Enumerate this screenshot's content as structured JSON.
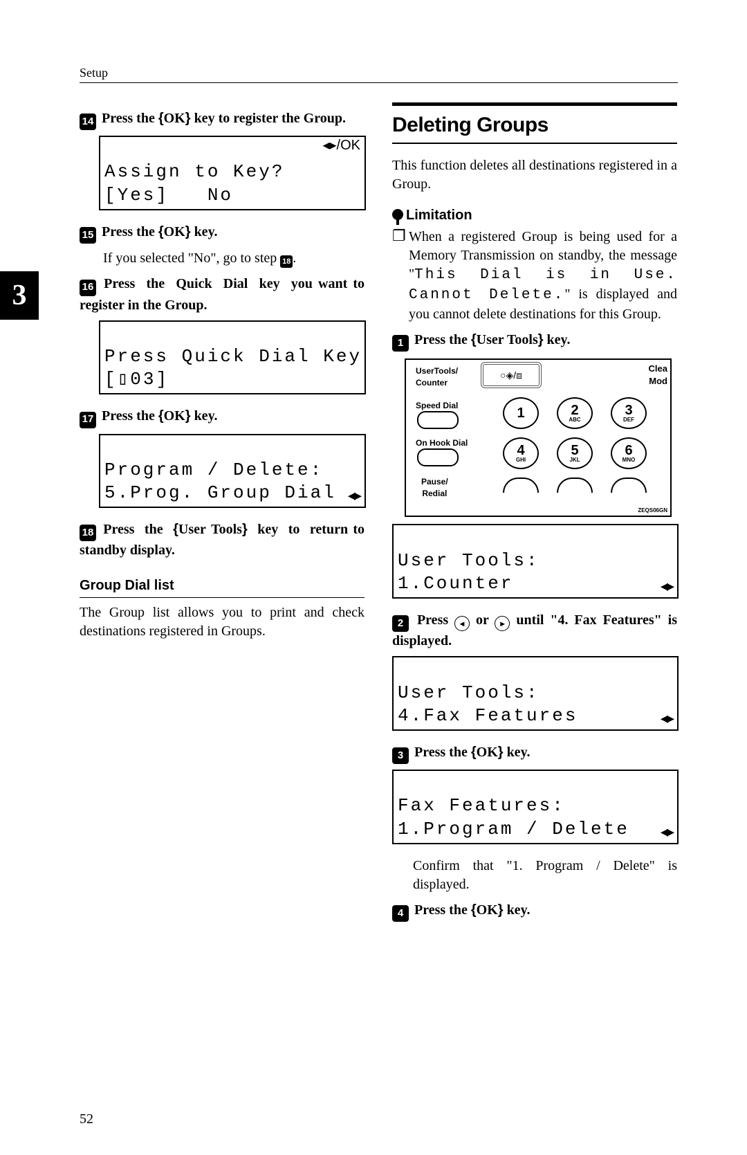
{
  "header": {
    "label": "Setup"
  },
  "chapter_tab": "3",
  "left": {
    "steps": {
      "s14": {
        "num": "14",
        "text": "Press the {OK} key to register the Group."
      },
      "lcd14": {
        "line1": "Assign to Key?",
        "right": "◂▸/OK",
        "line2": "[Yes]   No"
      },
      "s15": {
        "num": "15",
        "text": "Press the {OK} key."
      },
      "s15_body": "If you selected \"No\", go to step ",
      "s15_ref": "18",
      "s16": {
        "num": "16",
        "text": "Press the Quick Dial key you want to register in the Group."
      },
      "lcd16": {
        "line1": "Press Quick Dial Key",
        "line2": "[▯03]"
      },
      "s17": {
        "num": "17",
        "text": "Press the {OK} key."
      },
      "lcd17": {
        "line1": "Program / Delete:",
        "line2": "5.Prog. Group Dial",
        "arrows": "◂▸"
      },
      "s18": {
        "num": "18",
        "text": "Press the {User Tools} key to return to standby display."
      }
    },
    "subhead": "Group Dial list",
    "subbody": "The Group list allows you to print and check destinations registered in Groups."
  },
  "right": {
    "title": "Deleting Groups",
    "intro": "This function deletes all destinations registered in a Group.",
    "limit_label": "Limitation",
    "limit_body_a": "When a registered Group is being used for a Memory Transmission on standby, the message \"",
    "limit_mono": "This Dial is in Use. Cannot Delete.",
    "limit_body_b": "\" is displayed and you cannot delete destinations for this Group.",
    "steps": {
      "s1": {
        "num": "1",
        "text": "Press the {User Tools} key."
      },
      "panel": {
        "top1": "UserTools/",
        "top2": "Counter",
        "top_right1": "Clea",
        "top_right2": "Mod",
        "btn_symbols": "○◈/⧈",
        "label_speed": "Speed Dial",
        "label_hook": "On Hook Dial",
        "label_pause": "Pause/\nRedial",
        "keys": [
          {
            "n": "1",
            "s": ""
          },
          {
            "n": "2",
            "s": "ABC"
          },
          {
            "n": "3",
            "s": "DEF"
          },
          {
            "n": "4",
            "s": "GHI"
          },
          {
            "n": "5",
            "s": "JKL"
          },
          {
            "n": "6",
            "s": "MNO"
          }
        ],
        "code": "ZEQS06GN"
      },
      "lcd1": {
        "line1": "User Tools:",
        "line2": "1.Counter",
        "arrows": "◂▸"
      },
      "s2": {
        "num": "2",
        "text_a": "Press ",
        "text_b": " or ",
        "text_c": " until \"4. Fax Features\" is displayed."
      },
      "lcd2": {
        "line1": "User Tools:",
        "line2": "4.Fax Features",
        "arrows": "◂▸"
      },
      "s3": {
        "num": "3",
        "text": "Press the {OK} key."
      },
      "lcd3": {
        "line1": "Fax Features:",
        "line2": "1.Program / Delete",
        "arrows": "◂▸"
      },
      "s3_body": "Confirm that \"1. Program / Delete\" is displayed.",
      "s4": {
        "num": "4",
        "text": "Press the {OK} key."
      }
    }
  },
  "page_number": "52"
}
